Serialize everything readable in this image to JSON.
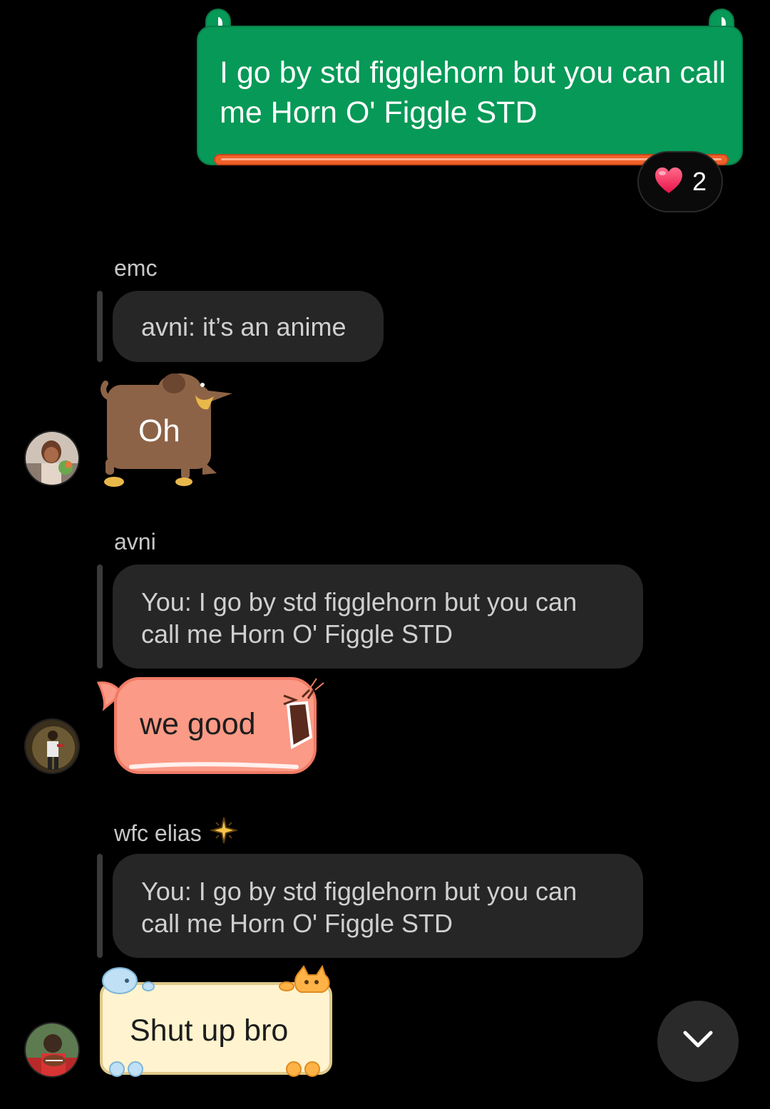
{
  "sent_message": {
    "text": "I go by std figglehorn but you can call me Horn O' Figgle STD",
    "theme_color": "#069957",
    "accent_color": "#f0602a"
  },
  "reaction": {
    "icon": "heart-icon",
    "count": "2"
  },
  "messages": [
    {
      "sender": "emc",
      "quote": "avni: it’s an anime",
      "reply": "Oh",
      "sticker": "dog-bubble",
      "sticker_color": "#8d6347"
    },
    {
      "sender": "avni",
      "quote": "You: I go by std figglehorn but you can call me Horn O' Figgle STD",
      "reply": "we good",
      "sticker": "fish-bubble",
      "sticker_color": "#fb9a86"
    },
    {
      "sender": "wfc elias",
      "sender_badge": "sparkle-icon",
      "quote": "You: I go by std figglehorn but you can call me Horn O' Figgle STD",
      "reply": "Shut up bro",
      "sticker": "pets-bubble",
      "sticker_color": "#fff4cf"
    }
  ],
  "scroll_button": {
    "icon": "chevron-down-icon"
  }
}
